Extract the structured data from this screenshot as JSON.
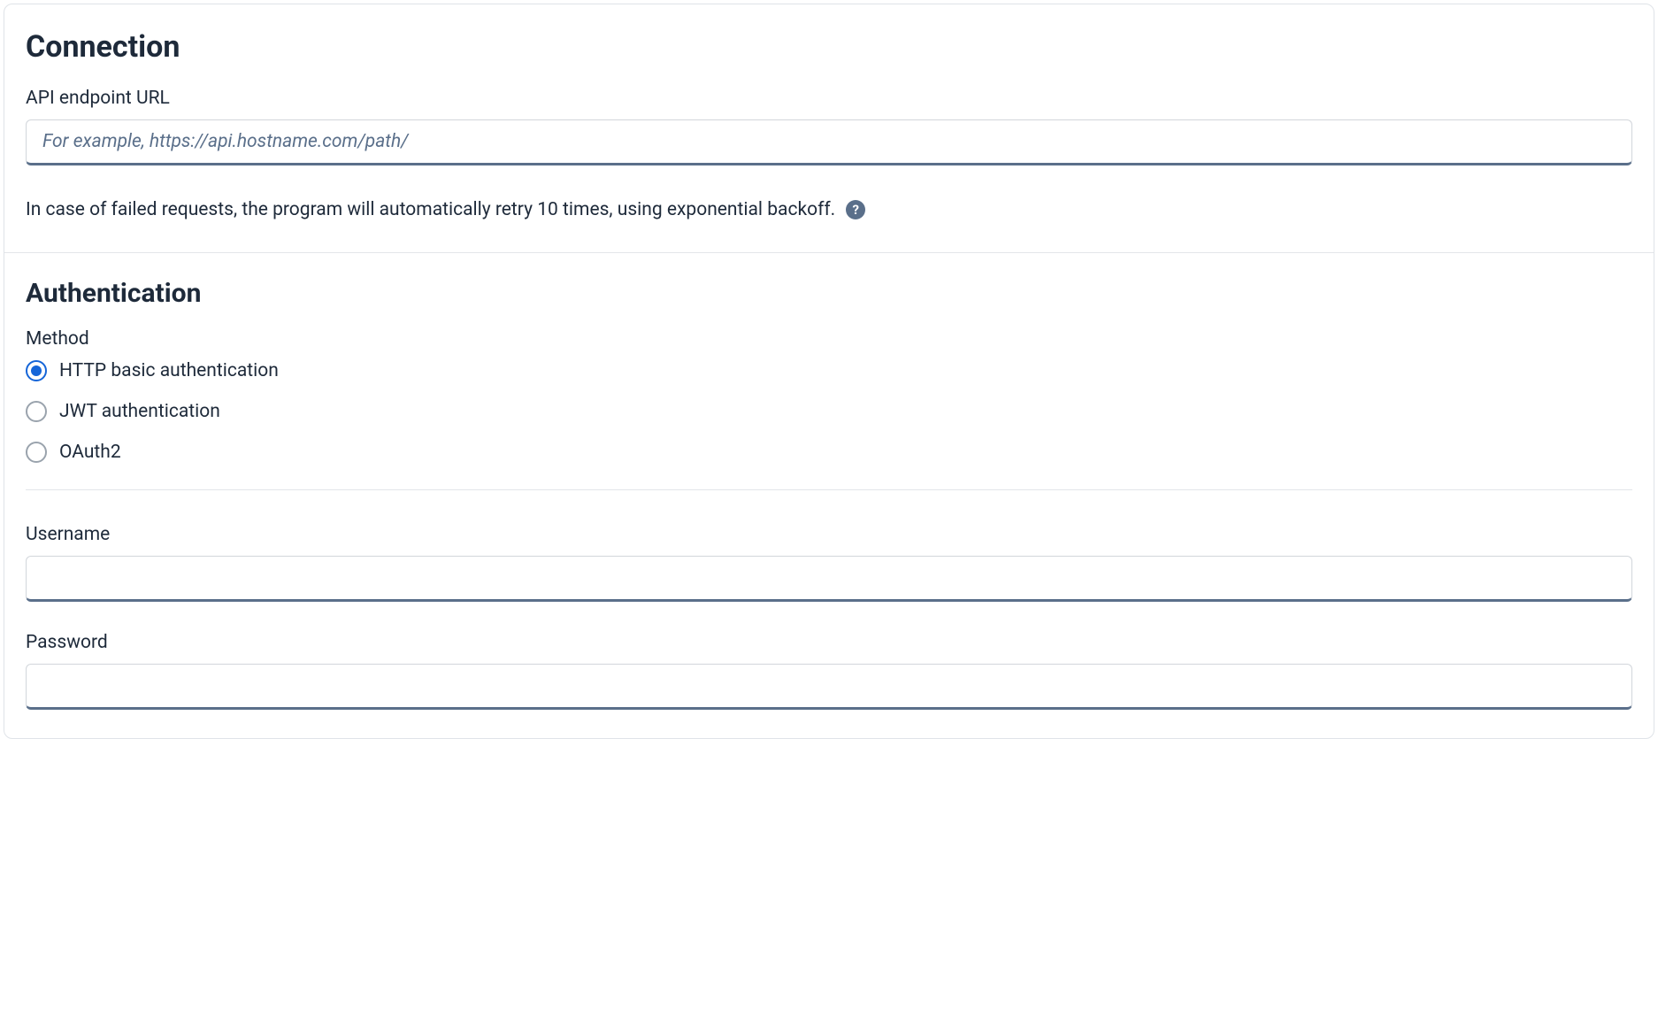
{
  "connection": {
    "title": "Connection",
    "api_endpoint_label": "API endpoint URL",
    "api_endpoint_placeholder": "For example, https://api.hostname.com/path/",
    "api_endpoint_value": "",
    "retry_helper": "In case of failed requests, the program will automatically retry 10 times, using exponential backoff.",
    "help_icon_glyph": "?"
  },
  "authentication": {
    "title": "Authentication",
    "method_label": "Method",
    "methods": [
      {
        "label": "HTTP basic authentication",
        "selected": true
      },
      {
        "label": "JWT authentication",
        "selected": false
      },
      {
        "label": "OAuth2",
        "selected": false
      }
    ],
    "username_label": "Username",
    "username_value": "",
    "password_label": "Password",
    "password_value": ""
  }
}
